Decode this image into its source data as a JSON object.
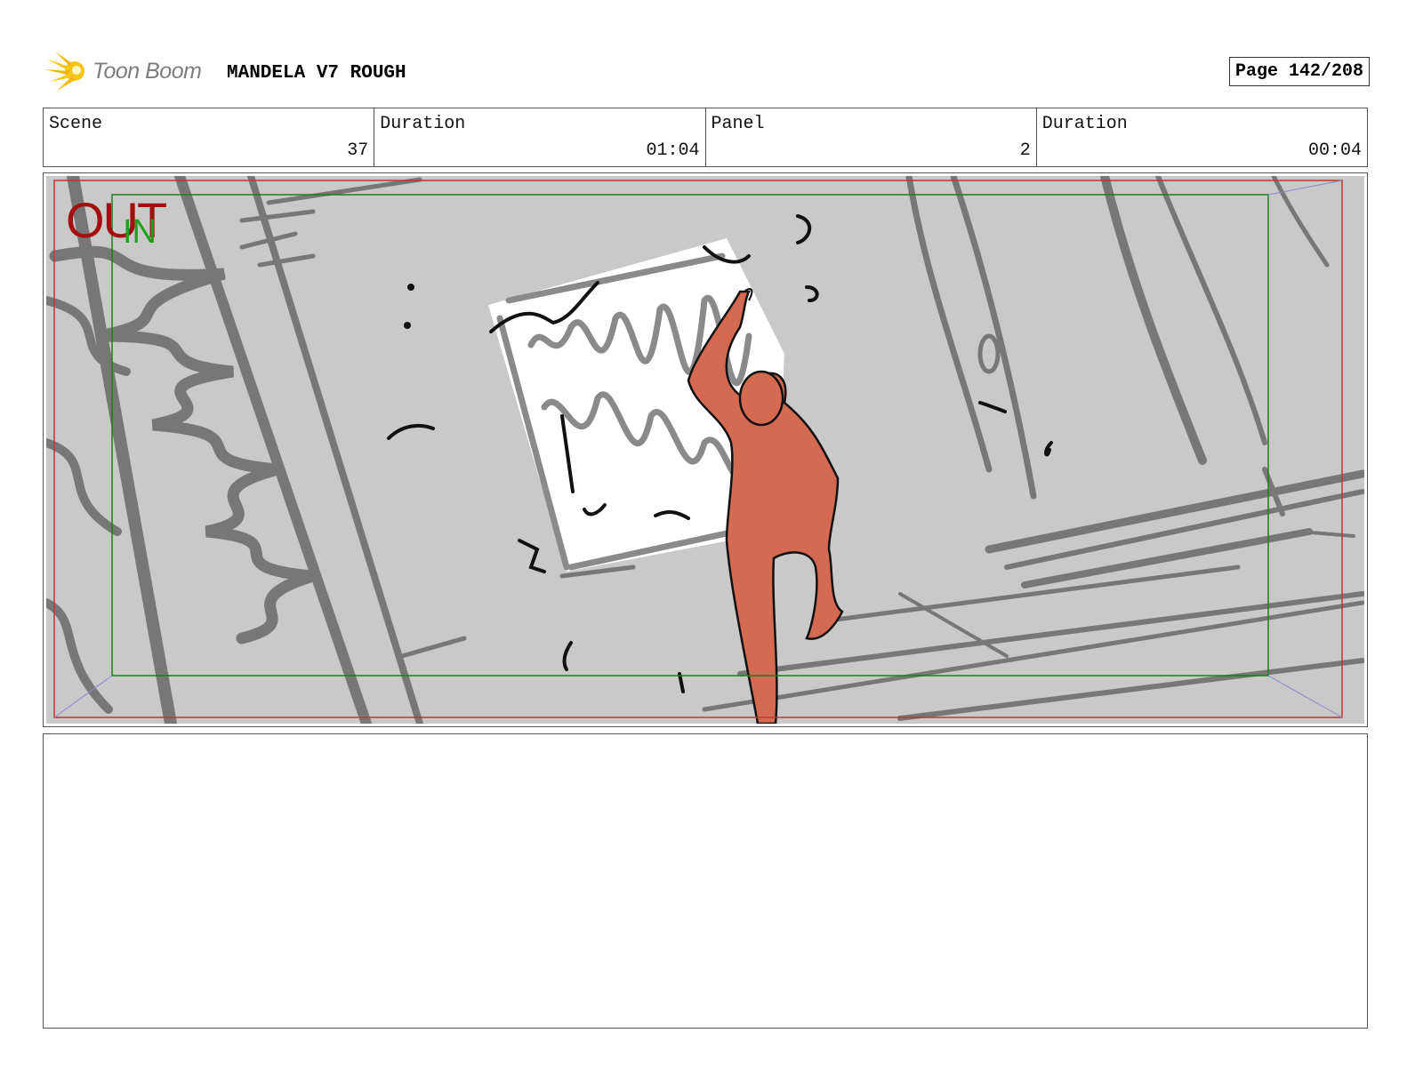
{
  "header": {
    "logo_text": "Toon Boom",
    "project_title": "MANDELA V7 ROUGH",
    "page_label": "Page 142/208"
  },
  "info": {
    "scene_label": "Scene",
    "scene_value": "37",
    "scene_duration_label": "Duration",
    "scene_duration_value": "01:04",
    "panel_label": "Panel",
    "panel_value": "2",
    "panel_duration_label": "Duration",
    "panel_duration_value": "00:04"
  },
  "panel": {
    "out_label": "OUT",
    "in_label": "IN"
  },
  "notes": {
    "text": ""
  },
  "colors": {
    "out_frame": "#c0392b",
    "in_frame": "#1e7e1e",
    "character_fill": "#d46a52",
    "background_gray": "#c8c8c8",
    "sketch_gray": "#7a7a7a"
  }
}
